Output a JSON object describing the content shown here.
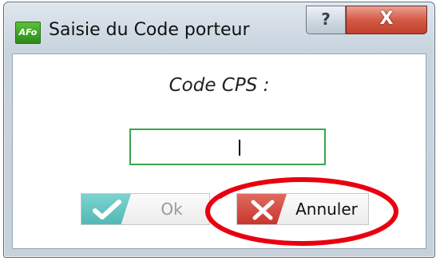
{
  "window": {
    "title": "Saisie du Code porteur",
    "app_icon_text": "AFo"
  },
  "titlebar": {
    "help_glyph": "?",
    "close_glyph": "X"
  },
  "form": {
    "label": "Code CPS :",
    "code_value": ""
  },
  "buttons": {
    "ok_label": "Ok",
    "ok_enabled": false,
    "cancel_label": "Annuler"
  },
  "colors": {
    "input_border": "#3aa64d",
    "ok_icon_bg": "#52b8b5",
    "cancel_icon_bg": "#c8362d",
    "close_button": "#c0402c",
    "annotation": "#e8000f"
  }
}
